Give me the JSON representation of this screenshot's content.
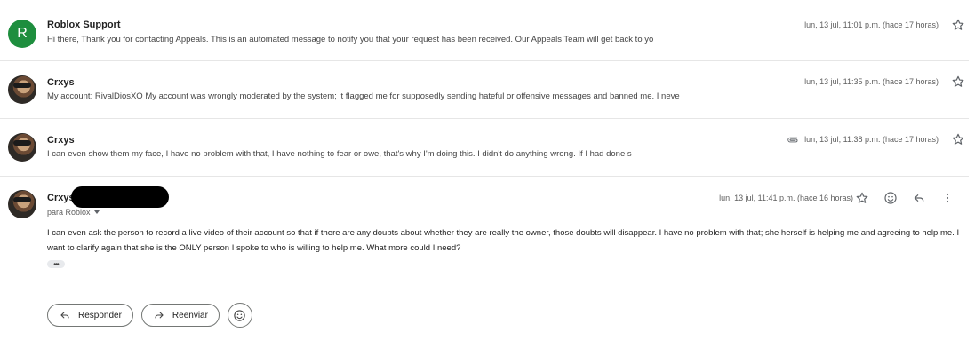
{
  "messages": [
    {
      "sender": "Roblox Support",
      "avatar_letter": "R",
      "snippet": "Hi there, Thank you for contacting Appeals. This is an automated message to notify you that your request has been received. Our Appeals Team will get back to yo",
      "time": "lun, 13 jul, 11:01 p.m. (hace 17 horas)",
      "has_attachment": false
    },
    {
      "sender": "Crxys",
      "snippet": "My account: RivalDiosXO My account was wrongly moderated by the system; it flagged me for supposedly sending hateful or offensive messages and banned me. I neve",
      "time": "lun, 13 jul, 11:35 p.m. (hace 17 horas)",
      "has_attachment": false
    },
    {
      "sender": "Crxys",
      "snippet": "I can even show them my face, I have no problem with that, I have nothing to fear or owe, that's why I'm doing this. I didn't do anything wrong. If I had done s",
      "time": "lun, 13 jul, 11:38 p.m. (hace 17 horas)",
      "has_attachment": true
    }
  ],
  "expanded": {
    "sender": "Crxys",
    "recipient": "para Roblox",
    "time": "lun, 13 jul, 11:41 p.m. (hace 16 horas)",
    "body": "I can even ask the person to record a live video of their account so that if there are any doubts about whether they are really the owner, those doubts will disappear. I have no problem with that; she herself is helping me and agreeing to help me. I want to clarify again that she is the ONLY person I spoke to who is willing to help me. What more could I need?",
    "more_label": "•••"
  },
  "buttons": {
    "reply": "Responder",
    "forward": "Reenviar"
  },
  "icons": [
    "star-icon",
    "paperclip-icon",
    "emoji-icon",
    "reply-icon",
    "more-vert-icon",
    "forward-icon"
  ],
  "colors": {
    "avatar_green": "#1e8e3e",
    "border": "#747775"
  }
}
